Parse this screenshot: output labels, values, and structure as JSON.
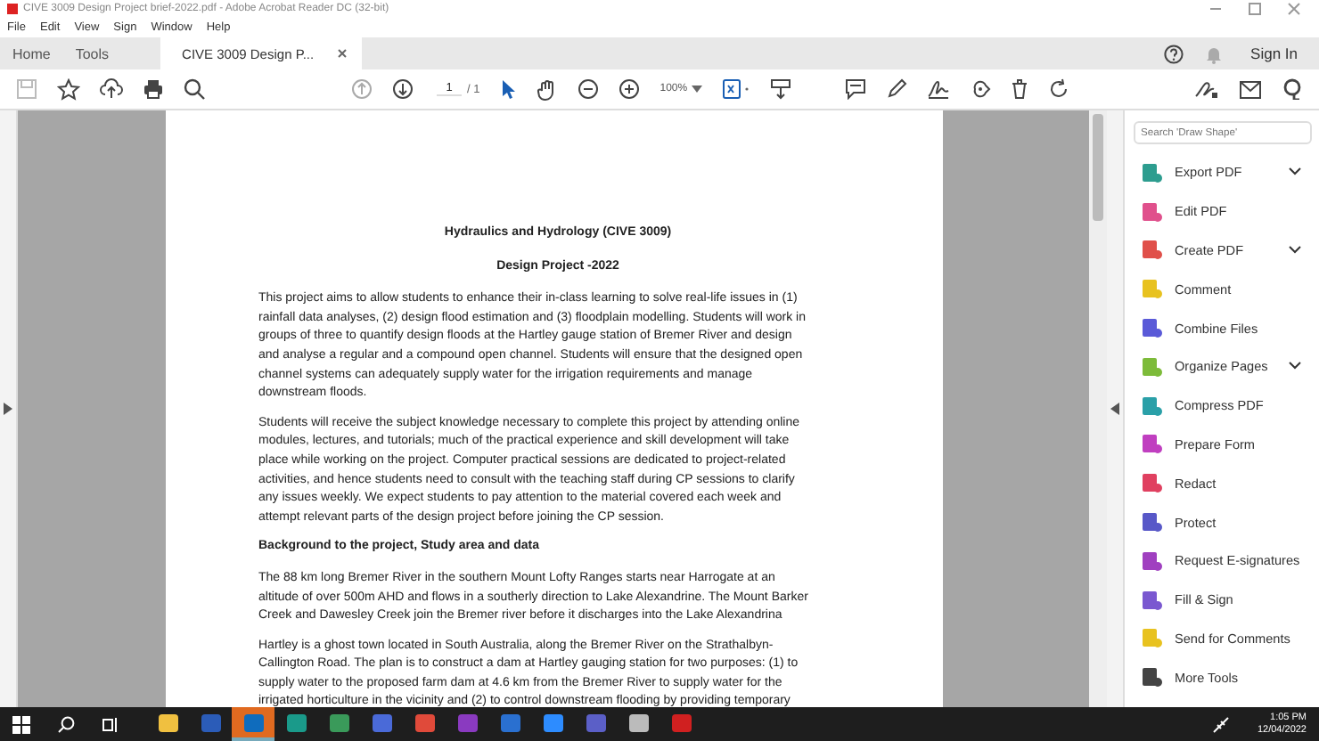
{
  "window": {
    "title": "CIVE 3009 Design Project brief-2022.pdf - Adobe Acrobat Reader DC (32-bit)"
  },
  "menu": [
    "File",
    "Edit",
    "View",
    "Sign",
    "Window",
    "Help"
  ],
  "tabs": [
    {
      "label": "Home",
      "selected": false,
      "closable": false
    },
    {
      "label": "Tools",
      "selected": false,
      "closable": false
    },
    {
      "label": "CIVE 3009 Design P...",
      "selected": true,
      "closable": true
    }
  ],
  "header_actions": {
    "sign_in": "Sign In"
  },
  "toolbar": {
    "page": "1",
    "page_total": "/ 1",
    "zoom": "100%"
  },
  "document": {
    "blocks": [
      {
        "kind": "title",
        "lines": [
          "Hydraulics and Hydrology (CIVE 3009)"
        ]
      },
      {
        "kind": "title",
        "lines": [
          "Design Project -2022"
        ]
      },
      {
        "kind": "paragraph",
        "lines": [
          "This project aims to allow students to enhance their in-class learning to solve real-life issues in (1)",
          "rainfall data analyses, (2) design flood estimation and (3) floodplain modelling. Students will work in",
          "groups of three to quantify design floods at the Hartley gauge station of Bremer River and design",
          "and analyse a regular and a compound open channel. Students will ensure that the designed open",
          "channel systems can adequately supply water for the irrigation requirements and manage",
          "downstream floods."
        ]
      },
      {
        "kind": "paragraph",
        "lines": [
          "Students will receive the subject knowledge necessary to complete this project by attending online",
          "modules, lectures, and tutorials; much of the practical experience and skill development will take",
          "place while working on the project. Computer practical sessions are dedicated to project-related",
          "activities, and hence students need to consult with the teaching staff during CP sessions to clarify",
          "any issues weekly. We expect students to pay attention to the material covered each week and",
          "attempt relevant parts of the design project before joining the CP session."
        ]
      },
      {
        "kind": "heading",
        "lines": [
          "Background to the project, Study area and data"
        ]
      },
      {
        "kind": "paragraph",
        "lines": [
          "The 88 km long Bremer River in the southern Mount Lofty Ranges starts near Harrogate at an",
          "altitude of over 500m AHD and flows in a  southerly direction to Lake Alexandrine. The Mount Barker",
          "Creek and Dawesley Creek join the Bremer river before it discharges into the Lake Alexandrina"
        ]
      },
      {
        "kind": "paragraph",
        "lines": [
          "Hartley is a ghost town located in South Australia, along the Bremer River on the Strathalbyn-",
          "Callington Road. The plan is to construct a dam at Hartley gauging station for two purposes: (1) to",
          "supply water to the proposed farm dam at 4.6 km from the Bremer River to supply water for the",
          "irrigated horticulture in the vicinity and (2) to control downstream flooding by providing temporary"
        ]
      }
    ]
  },
  "tools_panel": {
    "search": {
      "placeholder": "Search 'Draw Shape'"
    },
    "items": [
      {
        "label": "Export PDF",
        "color": "#2d9d8f",
        "has_menu": true
      },
      {
        "label": "Edit PDF",
        "color": "#e0508c",
        "has_menu": false
      },
      {
        "label": "Create PDF",
        "color": "#e0504a",
        "has_menu": true
      },
      {
        "label": "Comment",
        "color": "#e8c21f",
        "has_menu": false
      },
      {
        "label": "Combine Files",
        "color": "#5a5ad8",
        "has_menu": false
      },
      {
        "label": "Organize Pages",
        "color": "#7dbb3a",
        "has_menu": true
      },
      {
        "label": "Compress PDF",
        "color": "#2aa0a8",
        "has_menu": false
      },
      {
        "label": "Prepare Form",
        "color": "#c03fc0",
        "has_menu": false
      },
      {
        "label": "Redact",
        "color": "#e04060",
        "has_menu": false
      },
      {
        "label": "Protect",
        "color": "#5858c8",
        "has_menu": false
      },
      {
        "label": "Request E-signatures",
        "color": "#a040c0",
        "has_menu": false
      },
      {
        "label": "Fill & Sign",
        "color": "#7a58d0",
        "has_menu": false
      },
      {
        "label": "Send for Comments",
        "color": "#e8c21f",
        "has_menu": false
      },
      {
        "label": "More Tools",
        "color": "#444444",
        "has_menu": false
      }
    ]
  },
  "taskbar": {
    "apps": [
      {
        "color": "#f0c040",
        "active": false
      },
      {
        "color": "#2b5cb8",
        "active": false
      },
      {
        "color": "#0f6cbd",
        "active": true
      },
      {
        "color": "#1a9a8a",
        "active": false
      },
      {
        "color": "#3a9a5a",
        "active": false
      },
      {
        "color": "#4a6ad8",
        "active": false
      },
      {
        "color": "#e04a3a",
        "active": false
      },
      {
        "color": "#8a3ac0",
        "active": false
      },
      {
        "color": "#2a70d0",
        "active": false
      },
      {
        "color": "#2d8cff",
        "active": false
      },
      {
        "color": "#5b5fc7",
        "active": false
      },
      {
        "color": "#bbbbbb",
        "active": false
      },
      {
        "color": "#d02020",
        "active": false
      }
    ],
    "time": "1:05 PM",
    "date": "12/04/2022"
  }
}
